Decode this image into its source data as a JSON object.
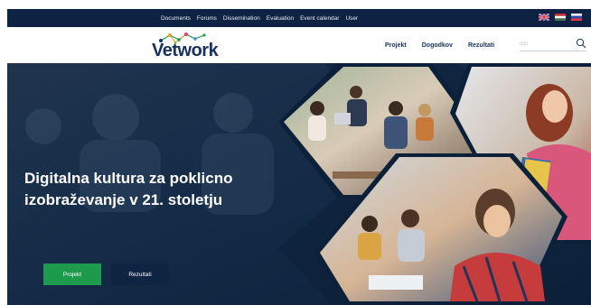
{
  "topbar": {
    "nav": [
      "Documents",
      "Forums",
      "Dissemination",
      "Evaluation",
      "Event calendar",
      "User"
    ],
    "flags": [
      "uk-flag",
      "hungary-flag",
      "slovenia-flag"
    ]
  },
  "header": {
    "logo_text": "Vetwork",
    "nav": [
      "Projekt",
      "Dogodkov",
      "Rezultati"
    ],
    "search_placeholder": "Išči",
    "search_value": ""
  },
  "hero": {
    "title_line1": "Digitalna kultura za poklicno",
    "title_line2": "izobraževanje v 21. stoletju",
    "button_primary": "Projekt",
    "button_secondary": "Rezultati"
  },
  "colors": {
    "navy": "#0e2343",
    "brand_dark": "#17325c",
    "accent_green": "#1e9a4d"
  }
}
